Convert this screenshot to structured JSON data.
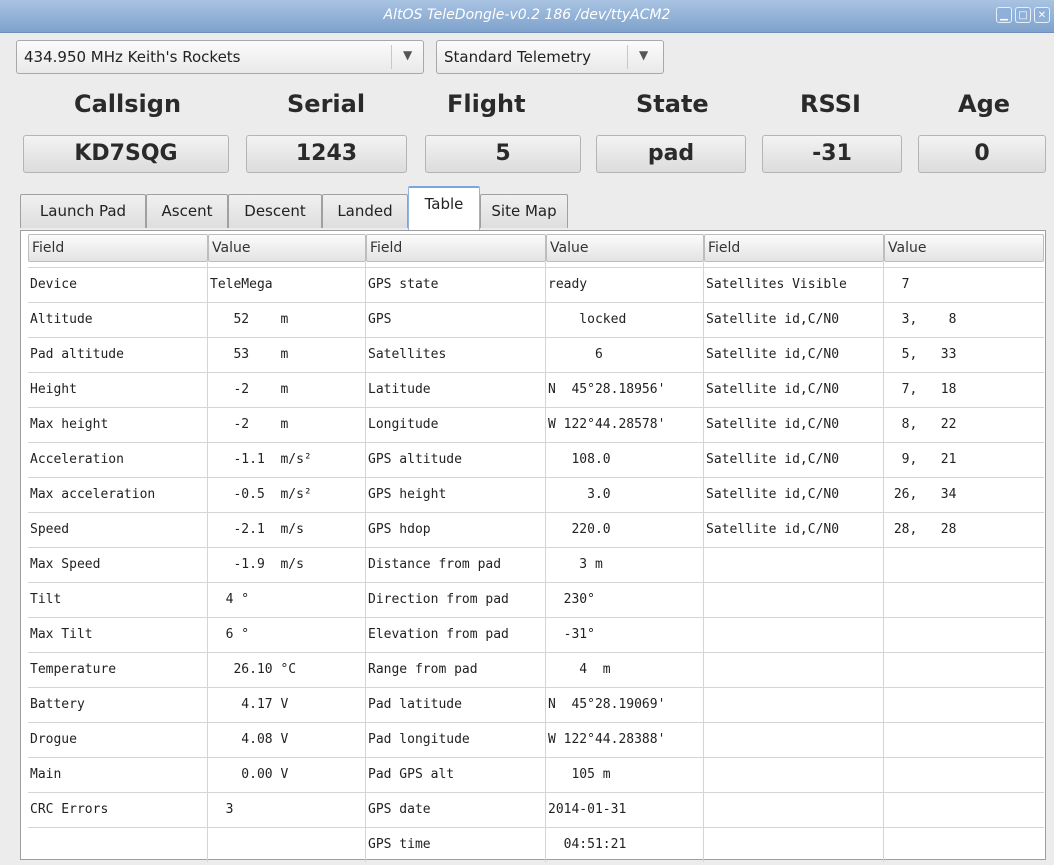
{
  "window": {
    "title": "AltOS TeleDongle-v0.2 186 /dev/ttyACM2",
    "buttons": [
      "minimize-icon",
      "maximize-icon",
      "close-icon"
    ]
  },
  "frequency_select": {
    "value": "434.950 MHz Keith's Rockets"
  },
  "telemetry_select": {
    "value": "Standard Telemetry"
  },
  "status": {
    "headers": [
      "Callsign",
      "Serial",
      "Flight",
      "State",
      "RSSI",
      "Age"
    ],
    "values": [
      "KD7SQG",
      "1243",
      "5",
      "pad",
      "-31",
      "0"
    ]
  },
  "tabs": [
    "Launch Pad",
    "Ascent",
    "Descent",
    "Landed",
    "Table",
    "Site Map"
  ],
  "active_tab": "Table",
  "table": {
    "headers": [
      "Field",
      "Value",
      "Field",
      "Value",
      "Field",
      "Value"
    ],
    "rows": [
      [
        "Device",
        "TeleMega",
        "GPS state",
        "ready",
        "Satellites Visible",
        "  7"
      ],
      [
        "Altitude",
        "   52    m",
        "GPS",
        "    locked",
        "Satellite id,C/N0",
        "  3,    8"
      ],
      [
        "Pad altitude",
        "   53    m",
        "Satellites",
        "      6",
        "Satellite id,C/N0",
        "  5,   33"
      ],
      [
        "Height",
        "   -2    m",
        "Latitude",
        "N  45°28.18956'",
        "Satellite id,C/N0",
        "  7,   18"
      ],
      [
        "Max height",
        "   -2    m",
        "Longitude",
        "W 122°44.28578'",
        "Satellite id,C/N0",
        "  8,   22"
      ],
      [
        "Acceleration",
        "   -1.1  m/s²",
        "GPS altitude",
        "   108.0",
        "Satellite id,C/N0",
        "  9,   21"
      ],
      [
        "Max acceleration",
        "   -0.5  m/s²",
        "GPS height",
        "     3.0",
        "Satellite id,C/N0",
        " 26,   34"
      ],
      [
        "Speed",
        "   -2.1  m/s",
        "GPS hdop",
        "   220.0",
        "Satellite id,C/N0",
        " 28,   28"
      ],
      [
        "Max Speed",
        "   -1.9  m/s",
        "Distance from pad",
        "    3 m",
        "",
        ""
      ],
      [
        "Tilt",
        "  4 °",
        "Direction from pad",
        "  230°",
        "",
        ""
      ],
      [
        "Max Tilt",
        "  6 °",
        "Elevation from pad",
        "  -31°",
        "",
        ""
      ],
      [
        "Temperature",
        "   26.10 °C",
        "Range from pad",
        "    4  m",
        "",
        ""
      ],
      [
        "Battery",
        "    4.17 V",
        "Pad latitude",
        "N  45°28.19069'",
        "",
        ""
      ],
      [
        "Drogue",
        "    4.08 V",
        "Pad longitude",
        "W 122°44.28388'",
        "",
        ""
      ],
      [
        "Main",
        "    0.00 V",
        "Pad GPS alt",
        "   105 m",
        "",
        ""
      ],
      [
        "CRC Errors",
        "  3",
        "GPS date",
        "2014-01-31",
        "",
        ""
      ],
      [
        "",
        "",
        "GPS time",
        "  04:51:21",
        "",
        ""
      ]
    ]
  }
}
